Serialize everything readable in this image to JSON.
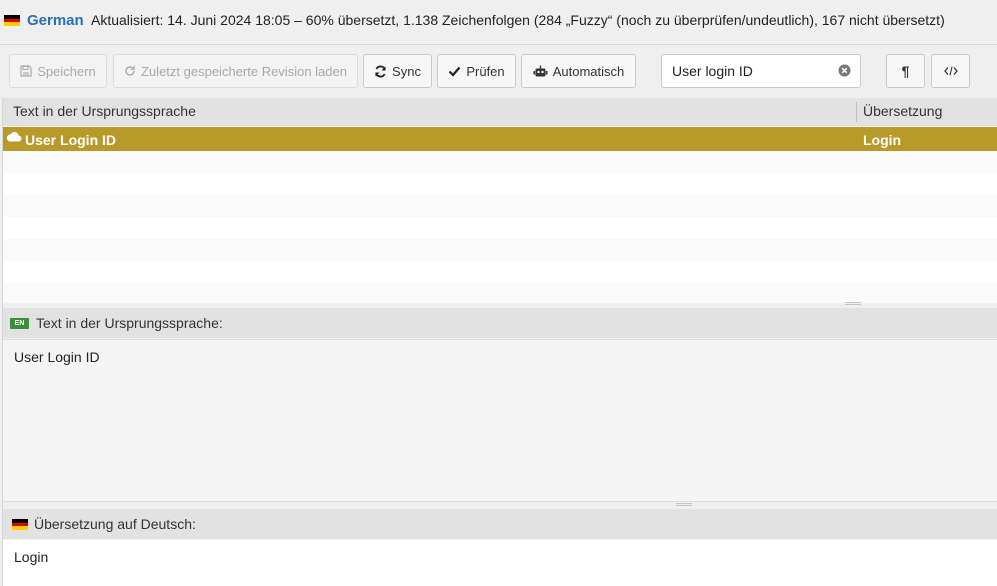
{
  "header": {
    "language": "German",
    "status": "Aktualisiert: 14. Juni 2024 18:05 – 60% übersetzt, 1.138 Zeichenfolgen (284 „Fuzzy“ (noch zu überprüfen/undeutlich), 167 nicht übersetzt)"
  },
  "toolbar": {
    "save_label": "Speichern",
    "revision_label": "Zuletzt gespeicherte Revision laden",
    "sync_label": "Sync",
    "check_label": "Prüfen",
    "auto_label": "Automatisch",
    "search_value": "User login ID",
    "pilcrow_label": "¶"
  },
  "list": {
    "headers": {
      "source": "Text in der Ursprungssprache",
      "target": "Übersetzung"
    },
    "rows": [
      {
        "source": "User Login ID",
        "target": "Login",
        "selected": true
      }
    ]
  },
  "source_panel": {
    "badge": "EN",
    "header": "Text in der Ursprungssprache:",
    "text": "User Login ID"
  },
  "target_panel": {
    "header": "Übersetzung auf Deutsch:",
    "text": "Login"
  },
  "colors": {
    "selected_row": "#b89a2a",
    "language_link": "#2a6fb0",
    "en_badge": "#3c8c3c"
  }
}
